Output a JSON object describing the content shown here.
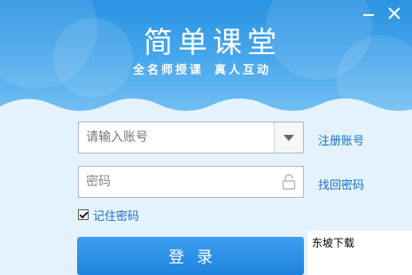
{
  "app": {
    "title": "简单课堂",
    "slogan_left": "全名师授课",
    "slogan_right": "真人互动"
  },
  "form": {
    "account_placeholder": "请输入账号",
    "password_placeholder": "密码",
    "register_label": "注册账号",
    "find_password_label": "找回密码",
    "remember_label": "记住密码",
    "remember_checked": true,
    "login_label": "登录"
  },
  "window_controls": [
    "minimize-icon",
    "close-icon"
  ],
  "colors": {
    "accent": "#2a8fe0",
    "link": "#1a6fc7",
    "header_top": "#2a93e3"
  },
  "watermark": {
    "text": "东坡下载"
  }
}
